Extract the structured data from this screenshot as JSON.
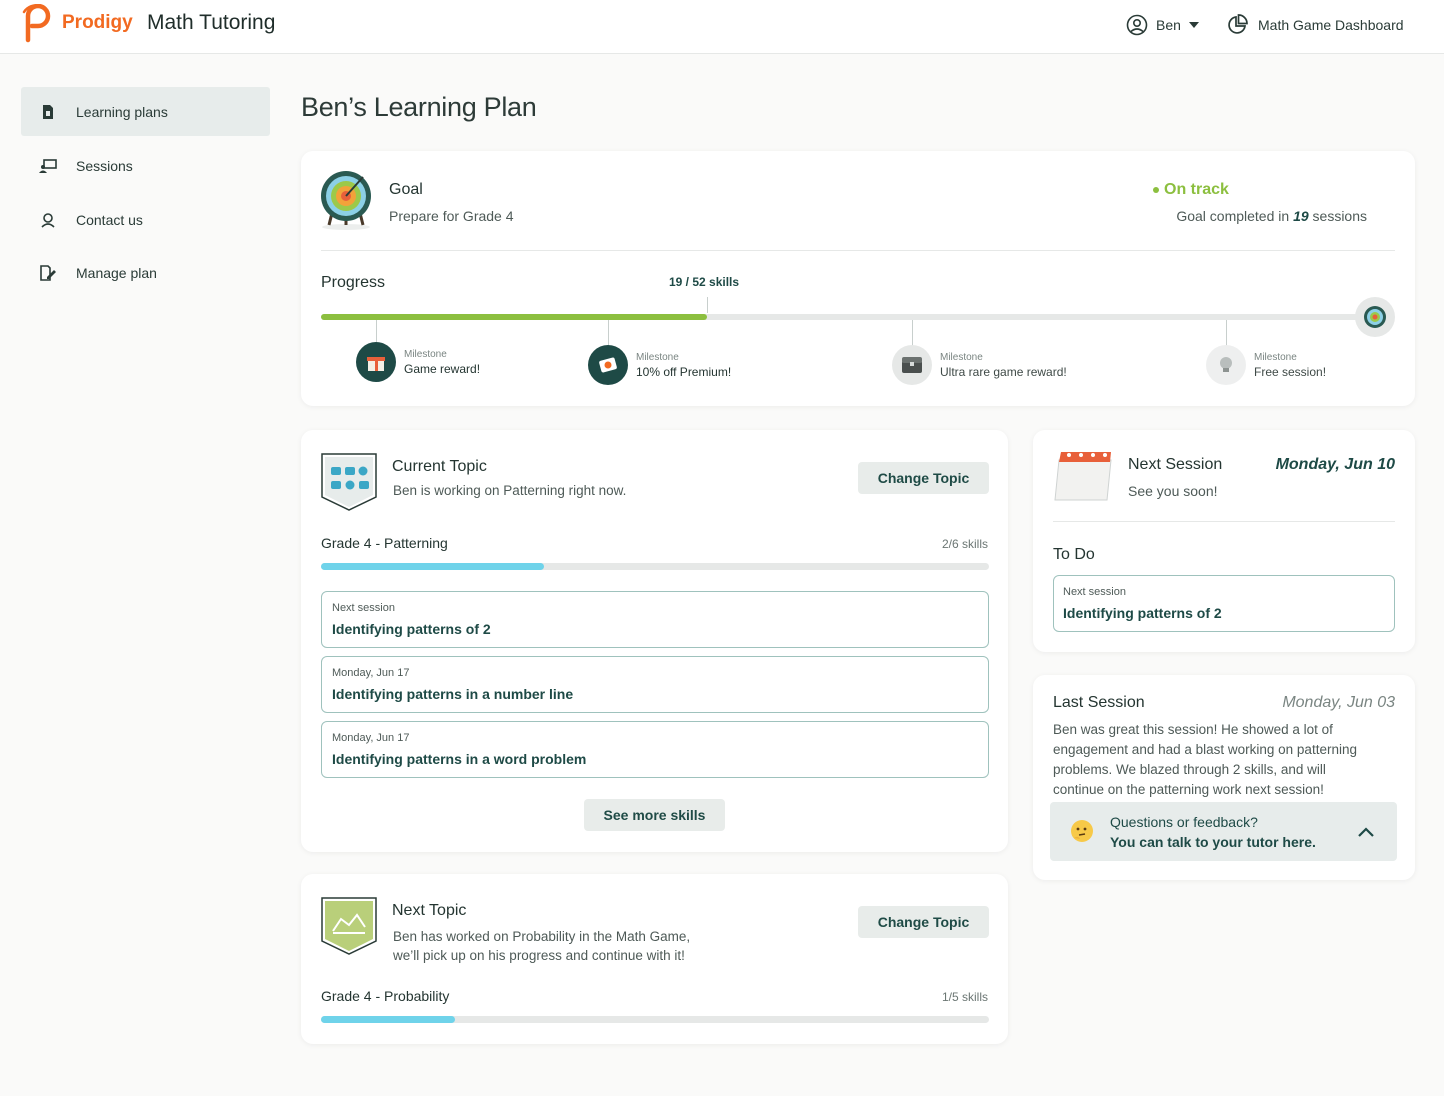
{
  "header": {
    "brand": "Prodigy",
    "app_title": "Math Tutoring",
    "user_name": "Ben",
    "dashboard_link": "Math Game Dashboard"
  },
  "sidebar": {
    "items": [
      {
        "label": "Learning plans",
        "icon": "document-icon",
        "active": true
      },
      {
        "label": "Sessions",
        "icon": "presentation-icon",
        "active": false
      },
      {
        "label": "Contact us",
        "icon": "support-agent-icon",
        "active": false
      },
      {
        "label": "Manage plan",
        "icon": "edit-document-icon",
        "active": false
      }
    ]
  },
  "page_title": "Ben’s Learning Plan",
  "goal": {
    "label": "Goal",
    "description": "Prepare for Grade 4",
    "status": "On track",
    "completed_prefix": "Goal completed in",
    "completed_count": "19",
    "completed_suffix": "sessions",
    "progress_label": "Progress",
    "progress_text": "19 / 52 skills",
    "progress_value": 19,
    "progress_total": 52,
    "milestones": [
      {
        "label": "Milestone",
        "reward": "Game reward!",
        "reached": true
      },
      {
        "label": "Milestone",
        "reward": "10% off Premium!",
        "reached": true
      },
      {
        "label": "Milestone",
        "reward": "Ultra rare game reward!",
        "reached": false
      },
      {
        "label": "Milestone",
        "reward": "Free session!",
        "reached": false
      }
    ]
  },
  "current_topic": {
    "title": "Current Topic",
    "description": "Ben is working on Patterning right now.",
    "change_button": "Change Topic",
    "topic_name": "Grade 4 - Patterning",
    "skills_text": "2/6 skills",
    "skills_done": 2,
    "skills_total": 6,
    "skills": [
      {
        "when": "Next session",
        "name": "Identifying patterns of 2"
      },
      {
        "when": "Monday, Jun 17",
        "name": "Identifying patterns in a number line"
      },
      {
        "when": "Monday, Jun 17",
        "name": "Identifying patterns in a word problem"
      }
    ],
    "see_more_button": "See more skills"
  },
  "next_topic": {
    "title": "Next Topic",
    "description_line1": "Ben has worked on Probability in the Math Game,",
    "description_line2": "we’ll pick up on his progress and continue with it!",
    "change_button": "Change Topic",
    "topic_name": "Grade 4 - Probability",
    "skills_text": "1/5 skills",
    "skills_done": 1,
    "skills_total": 5
  },
  "next_session": {
    "title": "Next Session",
    "date": "Monday, Jun 10",
    "subtitle": "See you soon!",
    "todo_title": "To Do",
    "todo_label": "Next session",
    "todo_value": "Identifying patterns of 2"
  },
  "last_session": {
    "title": "Last Session",
    "date": "Monday, Jun 03",
    "lines": [
      "Ben was great this session! He showed a lot of",
      "engagement and had a blast working on patterning",
      "problems. We blazed through 2 skills, and will",
      "continue on the patterning work next session!"
    ],
    "feedback_q": "Questions or feedback?",
    "feedback_cta": "You can talk to your tutor here."
  },
  "colors": {
    "brand_orange": "#f26a21",
    "progress_green": "#8cbf3f",
    "topic_blue": "#6fd3ea",
    "teal_dark": "#1e4a46"
  }
}
